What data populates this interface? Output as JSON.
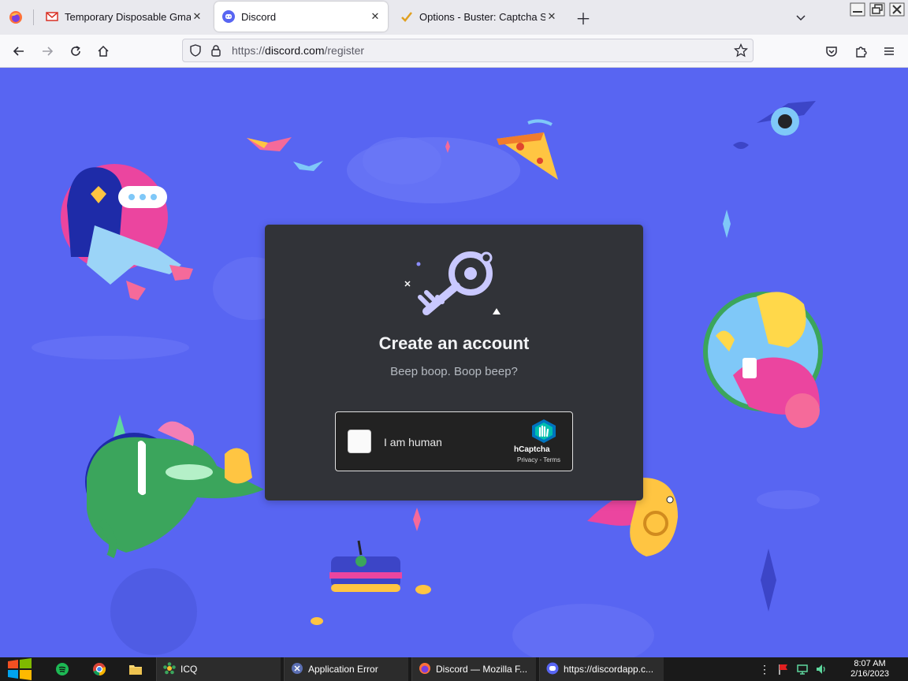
{
  "browser": {
    "tabs": [
      {
        "title": "Temporary Disposable Gmail |",
        "active": false
      },
      {
        "title": "Discord",
        "active": true
      },
      {
        "title": "Options - Buster: Captcha Sol",
        "active": false
      }
    ],
    "url": {
      "scheme": "https://",
      "host": "discord.com",
      "path": "/register"
    }
  },
  "page": {
    "title": "Create an account",
    "subtitle": "Beep boop. Boop beep?",
    "captcha": {
      "label": "I am human",
      "brand": "hCaptcha",
      "links": "Privacy - Terms"
    },
    "colors": {
      "background": "#5865f2",
      "card": "#313338"
    }
  },
  "taskbar": {
    "tasks": [
      {
        "label": "ICQ",
        "icon": "icq-icon"
      },
      {
        "label": "Application Error",
        "icon": "app-error-icon"
      },
      {
        "label": "Discord — Mozilla F...",
        "icon": "firefox-icon"
      },
      {
        "label": "https://discordapp.c...",
        "icon": "discord-icon"
      }
    ],
    "clock": {
      "time": "8:07 AM",
      "date": "2/16/2023"
    }
  }
}
